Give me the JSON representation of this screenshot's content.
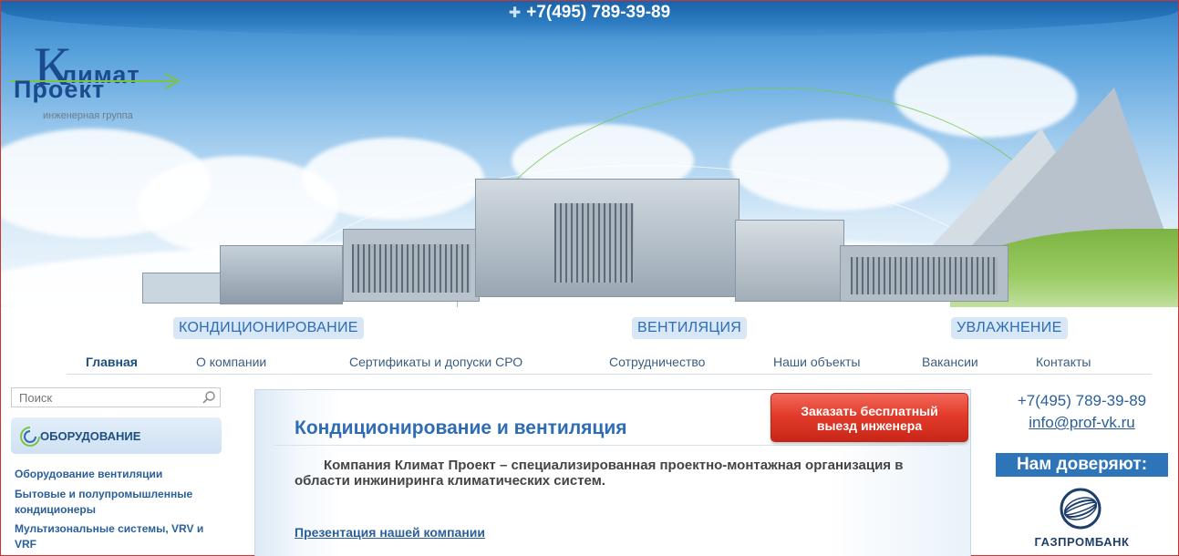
{
  "header": {
    "phone": "+7(495) 789-39-89",
    "logo": {
      "line1": "лимат",
      "line2": "роект",
      "letter_k": "К",
      "letter_p": "П",
      "subtitle": "инженерная группа"
    }
  },
  "categories": [
    {
      "label": "КОНДИЦИОНИРОВАНИЕ"
    },
    {
      "label": "ВЕНТИЛЯЦИЯ"
    },
    {
      "label": "УВЛАЖНЕНИЕ"
    }
  ],
  "nav": [
    {
      "label": "Главная",
      "active": true
    },
    {
      "label": "О компании"
    },
    {
      "label": "Сертификаты и допуски СРО"
    },
    {
      "label": "Сотрудничество"
    },
    {
      "label": "Наши объекты"
    },
    {
      "label": "Вакансии"
    },
    {
      "label": "Контакты"
    }
  ],
  "sidebar": {
    "search_placeholder": "Поиск",
    "equipment_label": "ОБОРУДОВАНИЕ",
    "links": [
      {
        "label": "Оборудование вентиляции"
      },
      {
        "label": "Бытовые и полупромышленные кондиционеры"
      },
      {
        "label": "Мультизональные системы, VRV и VRF"
      }
    ]
  },
  "content": {
    "title": "Кондиционирование и вентиляция",
    "text": "Компания Климат Проект – специализированная проектно-монтажная организация в области инжиниринга климатических систем.",
    "presentation_link": "Презентация нашей компании",
    "order_button_line1": "Заказать бесплатный",
    "order_button_line2": "выезд инженера"
  },
  "right": {
    "phone": "+7(495) 789-39-89",
    "email": "info@prof-vk.ru",
    "trust_heading": "Нам доверяют:",
    "partner_name": "ГАЗПРОМБАНК"
  },
  "colors": {
    "brand_blue": "#2e6db4",
    "topbar_blue": "#1a63a8",
    "order_red": "#e23b2b"
  }
}
